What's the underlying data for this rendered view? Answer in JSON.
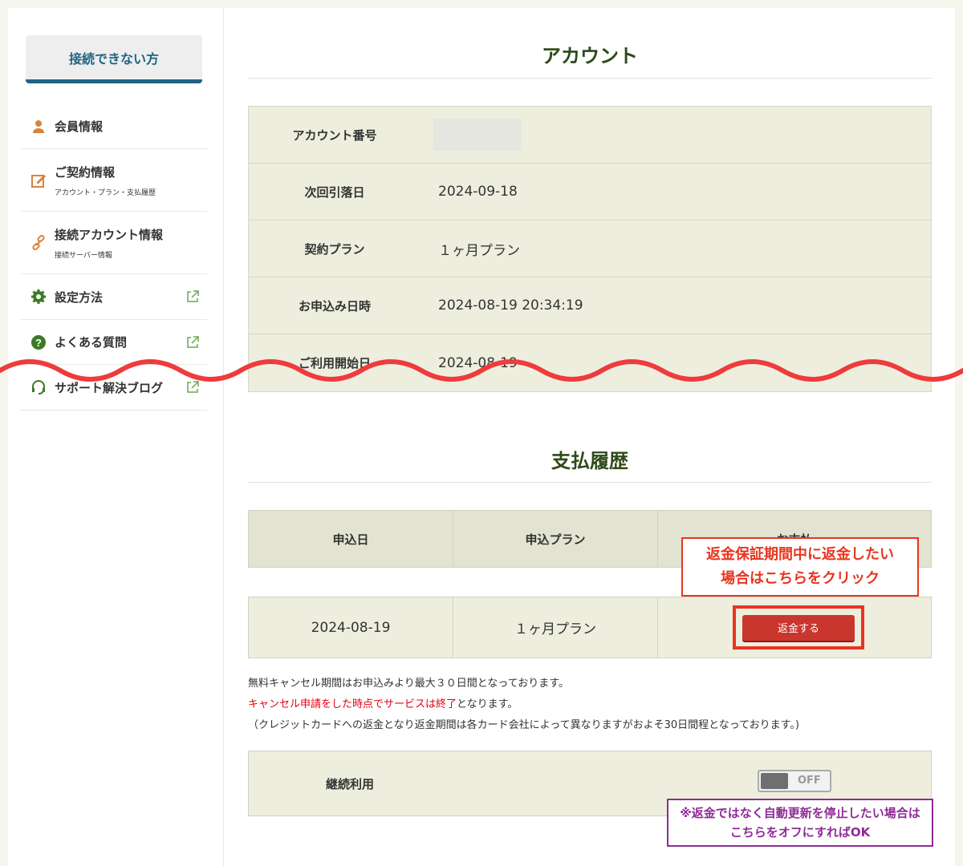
{
  "sidebar": {
    "cant_connect_label": "接続できない方",
    "items": [
      {
        "label": "会員情報",
        "sub": ""
      },
      {
        "label": "ご契約情報",
        "sub": "アカウント・プラン・支払履歴"
      },
      {
        "label": "接続アカウント情報",
        "sub": "接続サーバー情報"
      },
      {
        "label": "設定方法",
        "sub": ""
      },
      {
        "label": "よくある質問",
        "sub": ""
      },
      {
        "label": "サポート解決ブログ",
        "sub": ""
      }
    ]
  },
  "account": {
    "title": "アカウント",
    "rows": [
      {
        "key": "アカウント番号",
        "value": ""
      },
      {
        "key": "次回引落日",
        "value": "2024-09-18"
      },
      {
        "key": "契約プラン",
        "value": "１ヶ月プラン"
      },
      {
        "key": "お申込み日時",
        "value": "2024-08-19 20:34:19"
      },
      {
        "key": "ご利用開始日",
        "value": "2024-08-19"
      }
    ]
  },
  "payment": {
    "title": "支払履歴",
    "headers": [
      "申込日",
      "申込プラン",
      "お支払"
    ],
    "row": {
      "date": "2024-08-19",
      "plan": "１ヶ月プラン",
      "refund_label": "返金する"
    },
    "callout_line1": "返金保証期間中に返金したい",
    "callout_line2": "場合はこちらをクリック"
  },
  "notes": {
    "line1": "無料キャンセル期間はお申込みより最大３０日間となっております。",
    "line2_red": "キャンセル申請をした時点でサービスは終了",
    "line2_rest": "となります。",
    "line3": "（クレジットカードへの返金となり返金期間は各カード会社によって異なりますがおよそ30日間程となっております。)"
  },
  "continue": {
    "label": "継続利用",
    "toggle_state": "OFF",
    "callout_line1": "※返金ではなく自動更新を停止したい場合は",
    "callout_line2": "こちらをオフにすればOK"
  },
  "colors": {
    "accent_red": "#e8351f",
    "accent_purple": "#8e2c96",
    "title_green": "#2e4a1a",
    "brand_blue": "#1f6485"
  }
}
